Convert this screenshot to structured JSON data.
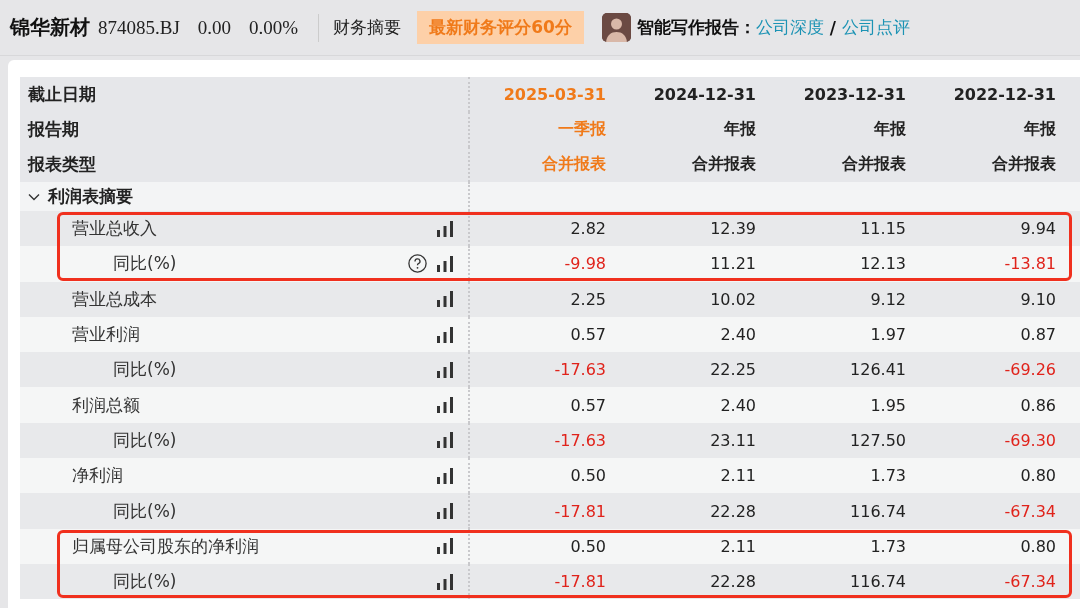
{
  "header": {
    "company": "锦华新材",
    "code": "874085.BJ",
    "price": "0.00",
    "change": "0.00%",
    "section": "财务摘要",
    "score_badge": "最新财务评分60分",
    "report_label": "智能写作报告：",
    "report_links": [
      {
        "label": "公司深度"
      },
      {
        "label": "公司点评"
      }
    ],
    "link_separator": "/"
  },
  "table": {
    "header_labels": [
      "截止日期",
      "报告期",
      "报表类型"
    ],
    "columns": [
      {
        "date": "2025-03-31",
        "period": "一季报",
        "type": "合并报表",
        "selected": true
      },
      {
        "date": "2024-12-31",
        "period": "年报",
        "type": "合并报表",
        "selected": false
      },
      {
        "date": "2023-12-31",
        "period": "年报",
        "type": "合并报表",
        "selected": false
      },
      {
        "date": "2022-12-31",
        "period": "年报",
        "type": "合并报表",
        "selected": false
      }
    ],
    "section": {
      "label": "利润表摘要",
      "expanded": true
    },
    "row_groups": [
      {
        "highlighted": true,
        "rows": [
          {
            "label": "营业总收入",
            "values": [
              {
                "text": "2.82",
                "negative": false
              },
              {
                "text": "12.39",
                "negative": false
              },
              {
                "text": "11.15",
                "negative": false
              },
              {
                "text": "9.94",
                "negative": false
              }
            ],
            "children": [
              {
                "label": "同比(%)",
                "help": true,
                "values": [
                  {
                    "text": "-9.98",
                    "negative": true
                  },
                  {
                    "text": "11.21",
                    "negative": false
                  },
                  {
                    "text": "12.13",
                    "negative": false
                  },
                  {
                    "text": "-13.81",
                    "negative": true
                  }
                ]
              }
            ]
          }
        ]
      },
      {
        "highlighted": false,
        "rows": [
          {
            "label": "营业总成本",
            "values": [
              {
                "text": "2.25",
                "negative": false
              },
              {
                "text": "10.02",
                "negative": false
              },
              {
                "text": "9.12",
                "negative": false
              },
              {
                "text": "9.10",
                "negative": false
              }
            ]
          },
          {
            "label": "营业利润",
            "values": [
              {
                "text": "0.57",
                "negative": false
              },
              {
                "text": "2.40",
                "negative": false
              },
              {
                "text": "1.97",
                "negative": false
              },
              {
                "text": "0.87",
                "negative": false
              }
            ],
            "children": [
              {
                "label": "同比(%)",
                "help": false,
                "values": [
                  {
                    "text": "-17.63",
                    "negative": true
                  },
                  {
                    "text": "22.25",
                    "negative": false
                  },
                  {
                    "text": "126.41",
                    "negative": false
                  },
                  {
                    "text": "-69.26",
                    "negative": true
                  }
                ]
              }
            ]
          },
          {
            "label": "利润总额",
            "values": [
              {
                "text": "0.57",
                "negative": false
              },
              {
                "text": "2.40",
                "negative": false
              },
              {
                "text": "1.95",
                "negative": false
              },
              {
                "text": "0.86",
                "negative": false
              }
            ],
            "children": [
              {
                "label": "同比(%)",
                "help": false,
                "values": [
                  {
                    "text": "-17.63",
                    "negative": true
                  },
                  {
                    "text": "23.11",
                    "negative": false
                  },
                  {
                    "text": "127.50",
                    "negative": false
                  },
                  {
                    "text": "-69.30",
                    "negative": true
                  }
                ]
              }
            ]
          },
          {
            "label": "净利润",
            "values": [
              {
                "text": "0.50",
                "negative": false
              },
              {
                "text": "2.11",
                "negative": false
              },
              {
                "text": "1.73",
                "negative": false
              },
              {
                "text": "0.80",
                "negative": false
              }
            ],
            "children": [
              {
                "label": "同比(%)",
                "help": false,
                "values": [
                  {
                    "text": "-17.81",
                    "negative": true
                  },
                  {
                    "text": "22.28",
                    "negative": false
                  },
                  {
                    "text": "116.74",
                    "negative": false
                  },
                  {
                    "text": "-67.34",
                    "negative": true
                  }
                ]
              }
            ]
          }
        ]
      },
      {
        "highlighted": true,
        "rows": [
          {
            "label": "归属母公司股东的净利润",
            "values": [
              {
                "text": "0.50",
                "negative": false
              },
              {
                "text": "2.11",
                "negative": false
              },
              {
                "text": "1.73",
                "negative": false
              },
              {
                "text": "0.80",
                "negative": false
              }
            ],
            "children": [
              {
                "label": "同比(%)",
                "help": false,
                "values": [
                  {
                    "text": "-17.81",
                    "negative": true
                  },
                  {
                    "text": "22.28",
                    "negative": false
                  },
                  {
                    "text": "116.74",
                    "negative": false
                  },
                  {
                    "text": "-67.34",
                    "negative": true
                  }
                ]
              }
            ]
          }
        ]
      }
    ]
  }
}
